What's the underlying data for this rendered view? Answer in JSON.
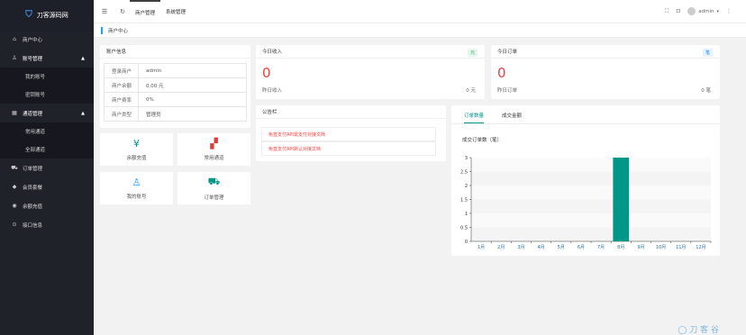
{
  "app": {
    "logo_icon": "⛉",
    "title": "刀客源码网"
  },
  "sidebar": {
    "home": "商户中心",
    "account_group": "账号管理",
    "account_items": [
      "我的账号",
      "密钥账号"
    ],
    "channel_group": "通道管理",
    "channel_items": [
      "常用通道",
      "全部通道"
    ],
    "orders": "订单管理",
    "members": "会员套餐",
    "recharge": "余额充值",
    "api": "接口信息"
  },
  "topbar": {
    "tab_merchant": "商户管理",
    "tab_settings": "系统管理",
    "user": "admin"
  },
  "breadcrumb": {
    "current": "商户中心"
  },
  "account_info": {
    "title": "账户信息",
    "rows": [
      {
        "k": "登录商户",
        "v": "admin"
      },
      {
        "k": "商户余额",
        "v": "0.00 元"
      },
      {
        "k": "商户费率",
        "v": "0%"
      },
      {
        "k": "商户类型",
        "v": "管理员"
      }
    ]
  },
  "quick": {
    "recharge": "余额充值",
    "channels": "常用通道",
    "account": "我的账号",
    "orders": "订单管理"
  },
  "income": {
    "title": "今日收入",
    "badge": "元",
    "value": "0",
    "sub": "昨日收入",
    "sub_val": "0 元"
  },
  "orders_today": {
    "title": "今日订单",
    "badge": "笔",
    "value": "0",
    "sub": "昨日订单",
    "sub_val": "0 笔"
  },
  "notice": {
    "title": "公告栏",
    "items": [
      "免签支付API需支付对接文档",
      "免签支付API默认对接文档"
    ]
  },
  "chart_tabs": {
    "active": "订单数量",
    "other": "成交金额"
  },
  "chart_data": {
    "type": "bar",
    "title": "成交订单数（笔）",
    "categories": [
      "1月",
      "2月",
      "3月",
      "4月",
      "5月",
      "6月",
      "7月",
      "8月",
      "9月",
      "10月",
      "11月",
      "12月"
    ],
    "values": [
      0,
      0,
      0,
      0,
      0,
      0,
      0,
      3,
      0,
      0,
      0,
      0
    ],
    "ylim": [
      0,
      3
    ],
    "yticks": [
      "0",
      "0.5",
      "1",
      "1.5",
      "2",
      "2.5",
      "3"
    ],
    "color": "#009688"
  },
  "watermark": "◯ 刀 客 谷"
}
